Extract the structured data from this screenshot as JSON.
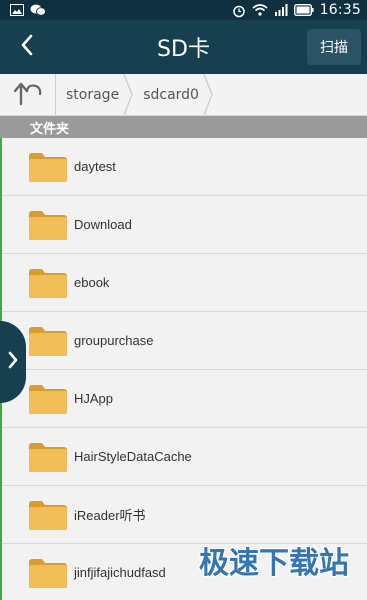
{
  "status_bar": {
    "time": "16:35",
    "left_icons": [
      "image-icon",
      "wechat-icon"
    ],
    "right_icons": [
      "alarm-icon",
      "wifi-icon",
      "signal-icon",
      "battery-icon"
    ]
  },
  "header": {
    "title": "SD卡",
    "scan_label": "扫描",
    "back_icon": "chevron-left-icon"
  },
  "breadcrumb": {
    "up_icon": "up-arrow-icon",
    "items": [
      "storage",
      "sdcard0"
    ]
  },
  "section": {
    "title": "文件夹"
  },
  "folders": [
    {
      "name": "daytest"
    },
    {
      "name": "Download"
    },
    {
      "name": "ebook"
    },
    {
      "name": "groupurchase"
    },
    {
      "name": "HJApp"
    },
    {
      "name": "HairStyleDataCache"
    },
    {
      "name": "iReader听书"
    },
    {
      "name": "jinfjifajichudfasd"
    }
  ],
  "watermark": "极速下载站",
  "colors": {
    "titlebar": "#163f50",
    "folder": "#e8b24a",
    "accent_green": "#38b13a"
  }
}
